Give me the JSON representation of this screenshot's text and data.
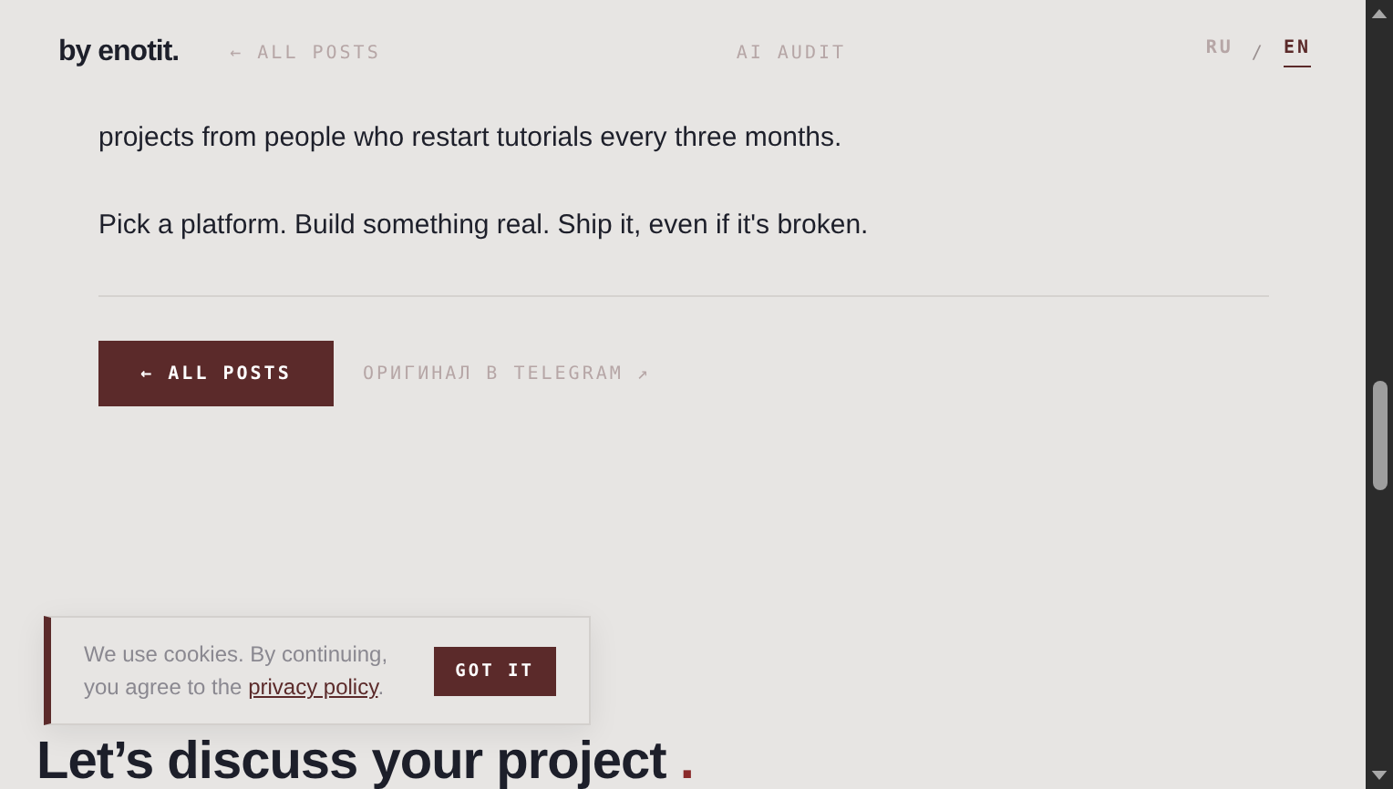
{
  "header": {
    "logo": "by enotit.",
    "back_link": "← ALL POSTS",
    "center_link": "AI AUDIT",
    "languages": [
      {
        "label": "RU",
        "selected": false
      },
      {
        "label": "EN",
        "selected": true
      }
    ],
    "language_separator": "/"
  },
  "article": {
    "paragraphs": [
      "projects from people who restart tutorials every three months.",
      "Pick a platform. Build something real. Ship it, even if it's broken."
    ]
  },
  "actions": {
    "back_button": "← ALL POSTS",
    "original_link": "ОРИГИНАЛ В TELEGRAM ↗"
  },
  "cta": {
    "heading": "Let’s discuss your project",
    "accent": "."
  },
  "cookie_banner": {
    "text": "We use cookies. By continuing, you agree to the ",
    "link": "privacy policy",
    "after": ".",
    "button": "GOT IT"
  }
}
